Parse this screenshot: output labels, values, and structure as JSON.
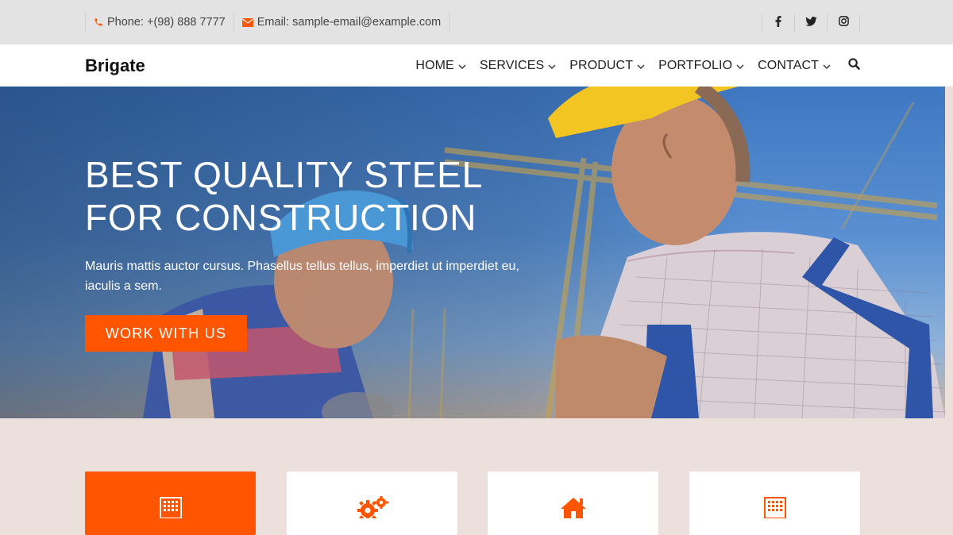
{
  "topbar": {
    "phone": "Phone: +(98) 888 7777",
    "email": "Email: sample-email@example.com",
    "social": [
      "facebook-icon",
      "twitter-icon",
      "instagram-icon"
    ]
  },
  "nav": {
    "brand": "Brigate",
    "items": [
      {
        "label": "HOME"
      },
      {
        "label": "SERVICES"
      },
      {
        "label": "PRODUCT"
      },
      {
        "label": "PORTFOLIO"
      },
      {
        "label": "CONTACT"
      }
    ],
    "search_icon": "search-icon"
  },
  "hero": {
    "headline_line1": "BEST QUALITY STEEL",
    "headline_line2": "FOR CONSTRUCTION",
    "description": "Mauris mattis auctor cursus. Phasellus tellus tellus, imperdiet ut imperdiet eu, iaculis a sem.",
    "cta_label": "WORK WITH US"
  },
  "features": {
    "cards": [
      {
        "icon": "building-icon",
        "active": true
      },
      {
        "icon": "gears-icon",
        "active": false
      },
      {
        "icon": "home-icon",
        "active": false
      },
      {
        "icon": "building-icon",
        "active": false
      }
    ]
  },
  "colors": {
    "accent": "#ff5400",
    "topbar_bg": "#e3e3e3",
    "section_bg": "#ece0dd"
  }
}
